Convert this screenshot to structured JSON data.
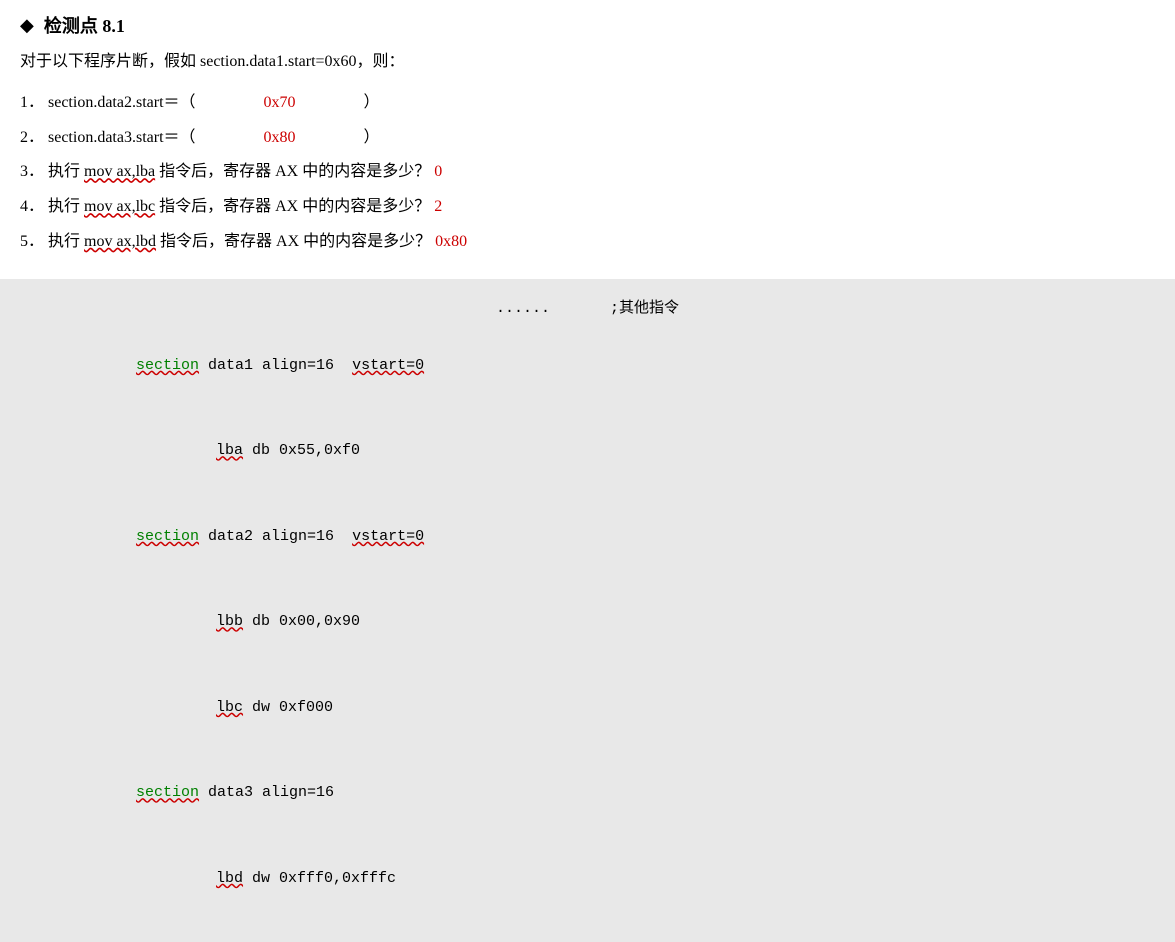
{
  "title": {
    "icon": "◆",
    "text": "检测点 8.1"
  },
  "intro": "对于以下程序片断，假如 section.data1.start=0x60，则：",
  "questions": [
    {
      "num": "1．",
      "text_before": "section.data2.start＝（",
      "answer": "0x70",
      "text_after": "）"
    },
    {
      "num": "2．",
      "text_before": "section.data3.start＝（",
      "answer": "0x80",
      "text_after": "）"
    },
    {
      "num": "3．",
      "text_before": "执行 mov ax,lba 指令后，寄存器 AX 中的内容是多少？",
      "answer": "0"
    },
    {
      "num": "4．",
      "text_before": "执行 mov ax,lbc 指令后，寄存器 AX 中的内容是多少？",
      "answer": "2"
    },
    {
      "num": "5．",
      "text_before": "执行 mov ax,lbd 指令后，寄存器 AX 中的内容是多少？",
      "answer": "0x80"
    }
  ],
  "code": {
    "dots": "......",
    "comment": ";其他指令",
    "lines": [
      {
        "indent": 1,
        "keyword": "section",
        "rest": " data1 align=16  vstart=0"
      },
      {
        "indent": 2,
        "label": "lba",
        "rest": " db 0x55,0xf0"
      },
      {
        "indent": 1,
        "keyword": "section",
        "rest": " data2 align=16  vstart=0"
      },
      {
        "indent": 2,
        "label": "lbb",
        "rest": " db 0x00,0x90"
      },
      {
        "indent": 2,
        "label": "lbc",
        "rest": " dw 0xf000"
      },
      {
        "indent": 1,
        "keyword": "section",
        "rest": " data3 align=16"
      },
      {
        "indent": 2,
        "label": "lbd",
        "rest": " dw 0xfff0,0xfffc"
      }
    ]
  }
}
